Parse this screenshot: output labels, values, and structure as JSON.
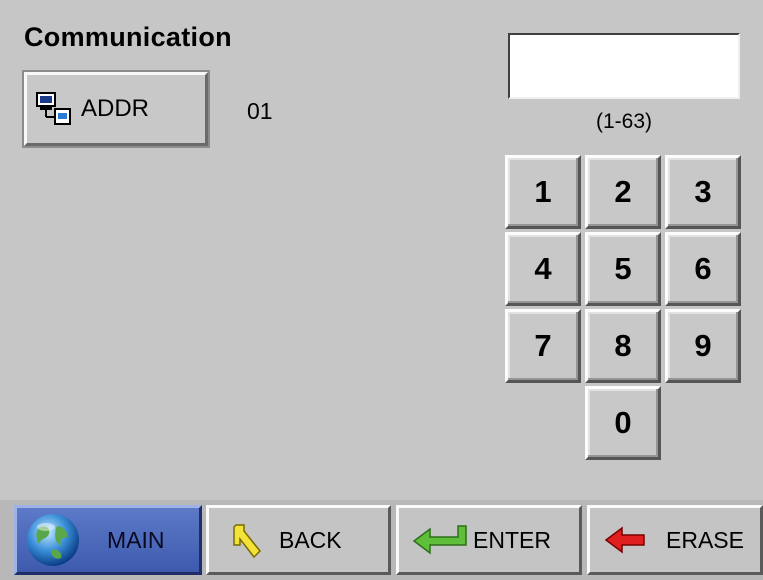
{
  "screen": {
    "title": "Communication"
  },
  "addr": {
    "label": "ADDR",
    "icon": "network-computers-icon",
    "value": "01"
  },
  "entry": {
    "value": "",
    "range_hint": "(1-63)"
  },
  "keypad": {
    "keys": [
      "1",
      "2",
      "3",
      "4",
      "5",
      "6",
      "7",
      "8",
      "9",
      "0"
    ]
  },
  "nav": {
    "main": {
      "label": "MAIN",
      "icon": "globe-icon"
    },
    "back": {
      "label": "BACK",
      "icon": "back-arrow-icon"
    },
    "enter": {
      "label": "ENTER",
      "icon": "enter-arrow-icon"
    },
    "erase": {
      "label": "ERASE",
      "icon": "erase-arrow-icon"
    }
  },
  "colors": {
    "background": "#c6c6c6",
    "main_button": "#4a68b8",
    "back_icon": "#f2e23a",
    "enter_icon": "#5fbf3a",
    "erase_icon": "#e02020"
  }
}
